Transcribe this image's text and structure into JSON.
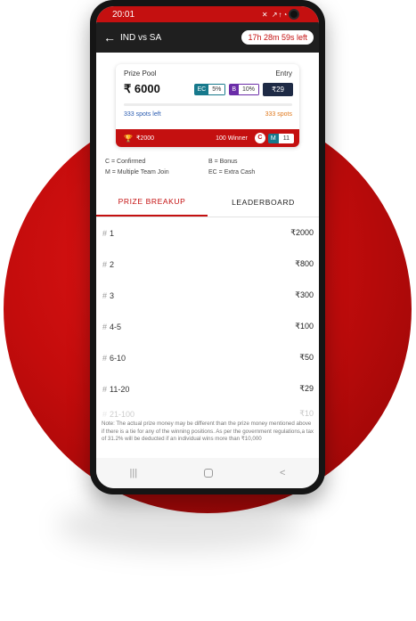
{
  "status_bar": {
    "time": "20:01",
    "icons": "✕ ↗↑◔ ▮"
  },
  "header": {
    "back_icon": "arrow-left-icon",
    "title": "IND vs SA",
    "time_left": "17h 28m 59s left"
  },
  "contest": {
    "prize_pool_label": "Prize Pool",
    "entry_label": "Entry",
    "prize_pool": "₹ 6000",
    "ec_label": "EC",
    "ec_value": "5%",
    "bonus_label": "B",
    "bonus_value": "10%",
    "entry_fee": "₹29",
    "spots_left": "333 spots left",
    "total_spots": "333 spots",
    "spots_filled_fraction": 0.0,
    "first_prize": "₹2000",
    "winners": "100 Winner",
    "confirmed_badge": "C",
    "multi_label": "M",
    "multi_value": "11"
  },
  "legend": {
    "confirmed": "C = Confirmed",
    "bonus": "B = Bonus",
    "multiple": "M = Multiple Team Join",
    "extra_cash": "EC = Extra Cash"
  },
  "tabs": {
    "prize_breakup": "PRIZE BREAKUP",
    "leaderboard": "LEADERBOARD"
  },
  "breakup": [
    {
      "rank": "1",
      "amount": "₹2000"
    },
    {
      "rank": "2",
      "amount": "₹800"
    },
    {
      "rank": "3",
      "amount": "₹300"
    },
    {
      "rank": "4-5",
      "amount": "₹100"
    },
    {
      "rank": "6-10",
      "amount": "₹50"
    },
    {
      "rank": "11-20",
      "amount": "₹29"
    },
    {
      "rank": "21-100",
      "amount": "₹10"
    }
  ],
  "hash_symbol": "#",
  "note": "Note: The actual prize money may be different than the prize money mentioned above if there is a tie for any of the winning positions. As per the government regulations,a tax of 31.2% will be deducted if an individual wins more than ₹10,000",
  "nav": {
    "recents": "|||",
    "back": "<"
  },
  "colors": {
    "brand_red": "#c41010",
    "header_dark": "#1f1f1f",
    "ec_teal": "#17798c",
    "bonus_purple": "#6a2ca8",
    "entry_navy": "#1e2a45"
  }
}
